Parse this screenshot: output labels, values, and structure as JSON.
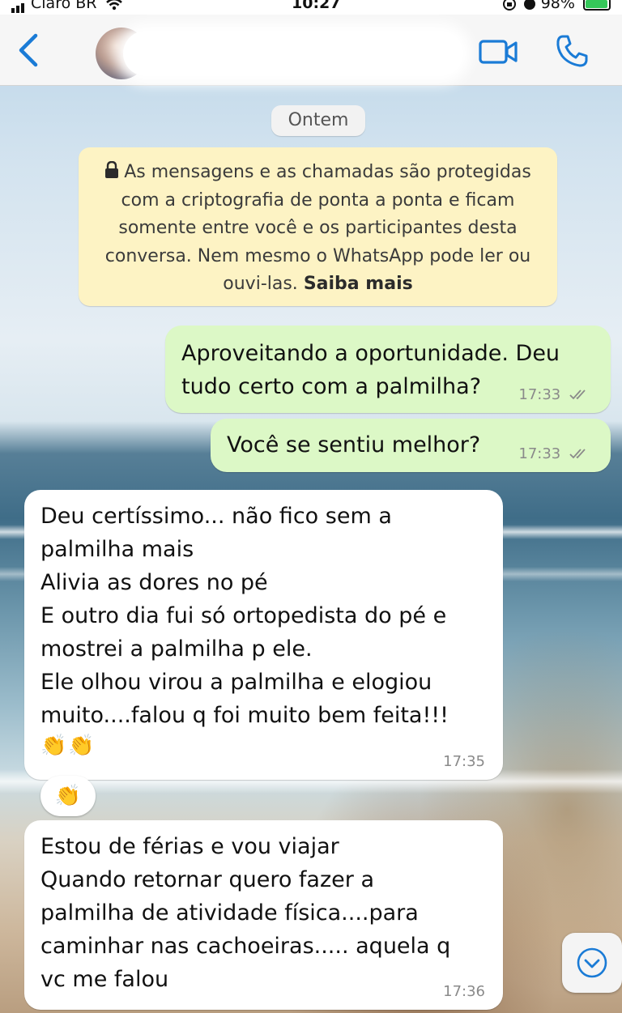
{
  "status_bar": {
    "carrier": "Claro BR",
    "time": "10:27",
    "battery": "98%"
  },
  "header": {
    "contact_name": "",
    "icons": [
      "back-icon",
      "avatar",
      "video-call-icon",
      "phone-call-icon"
    ]
  },
  "chat": {
    "date_label": "Ontem",
    "encryption_note": {
      "text": "As mensagens e as chamadas são protegidas com a criptografia de ponta a ponta e ficam somente entre você e os participantes desta conversa. Nem mesmo o WhatsApp pode ler ou ouvi-las.",
      "link": "Saiba mais"
    },
    "messages": [
      {
        "direction": "out",
        "text": "Aproveitando a oportunidade. Deu\ntudo certo com a palmilha?",
        "time": "17:33",
        "status": "delivered"
      },
      {
        "direction": "out",
        "text": "Você se sentiu melhor?",
        "time": "17:33",
        "status": "delivered"
      },
      {
        "direction": "in",
        "text": "Deu certíssimo... não fico sem a\npalmilha mais\nAlivia as dores no pé\nE outro dia fui só ortopedista do pé e\nmostrei a palmilha p ele.\nEle olhou virou a palmilha e elogiou\nmuito....falou q foi muito bem feita!!!",
        "emoji": "👏👏",
        "time": "17:35"
      },
      {
        "direction": "in",
        "type": "reaction",
        "emoji": "👏"
      },
      {
        "direction": "in",
        "text": "Estou de férias e vou viajar\nQuando retornar quero fazer a\npalmilha de atividade física....para\ncaminhar nas cachoeiras..... aquela q\nvc me falou",
        "time": "17:36"
      }
    ]
  },
  "colors": {
    "outgoing_bubble": "#dcf8c6",
    "incoming_bubble": "#ffffff",
    "ios_blue": "#1a7bd6",
    "encryption_note_bg": "#fdf3c4"
  }
}
